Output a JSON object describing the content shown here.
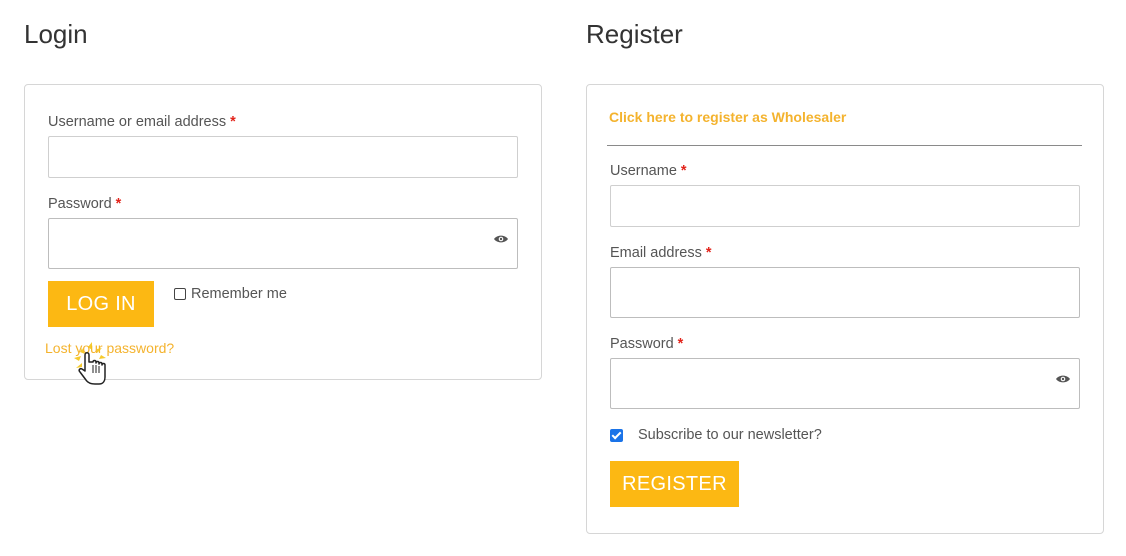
{
  "login": {
    "heading": "Login",
    "username_label": "Username or email address",
    "password_label": "Password",
    "required_marker": "*",
    "login_button": "LOG IN",
    "remember_label": "Remember me",
    "remember_checked": false,
    "lost_password_link": "Lost your password?",
    "password_toggle_icon": "eye-icon"
  },
  "register": {
    "heading": "Register",
    "wholesaler_link": "Click here to register as Wholesaler",
    "username_label": "Username",
    "email_label": "Email address",
    "password_label": "Password",
    "required_marker": "*",
    "newsletter_label": "Subscribe to our newsletter?",
    "newsletter_checked": true,
    "register_button": "REGISTER",
    "password_toggle_icon": "eye-icon"
  },
  "colors": {
    "accent": "#fcb813",
    "link": "#f4b32e",
    "required": "#e2231a",
    "checkbox": "#1a73e8"
  },
  "cursor": {
    "icon": "hand-pointer-icon"
  }
}
